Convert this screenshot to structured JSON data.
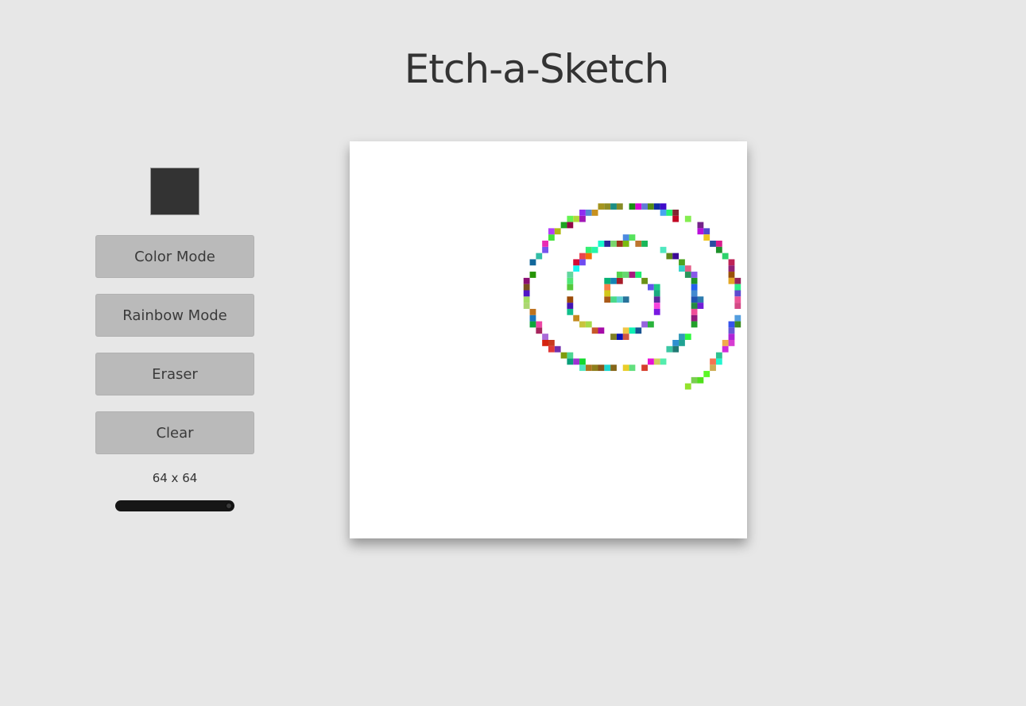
{
  "header": {
    "title": "Etch-a-Sketch"
  },
  "controls": {
    "current_color": "#333333",
    "buttons": {
      "color_mode": "Color Mode",
      "rainbow_mode": "Rainbow Mode",
      "eraser": "Eraser",
      "clear": "Clear"
    },
    "grid_size_label": "64 x 64",
    "grid_size": 64,
    "slider_value_fraction": 1.0
  },
  "board": {
    "background": "#ffffff",
    "grid_cells": 64
  }
}
